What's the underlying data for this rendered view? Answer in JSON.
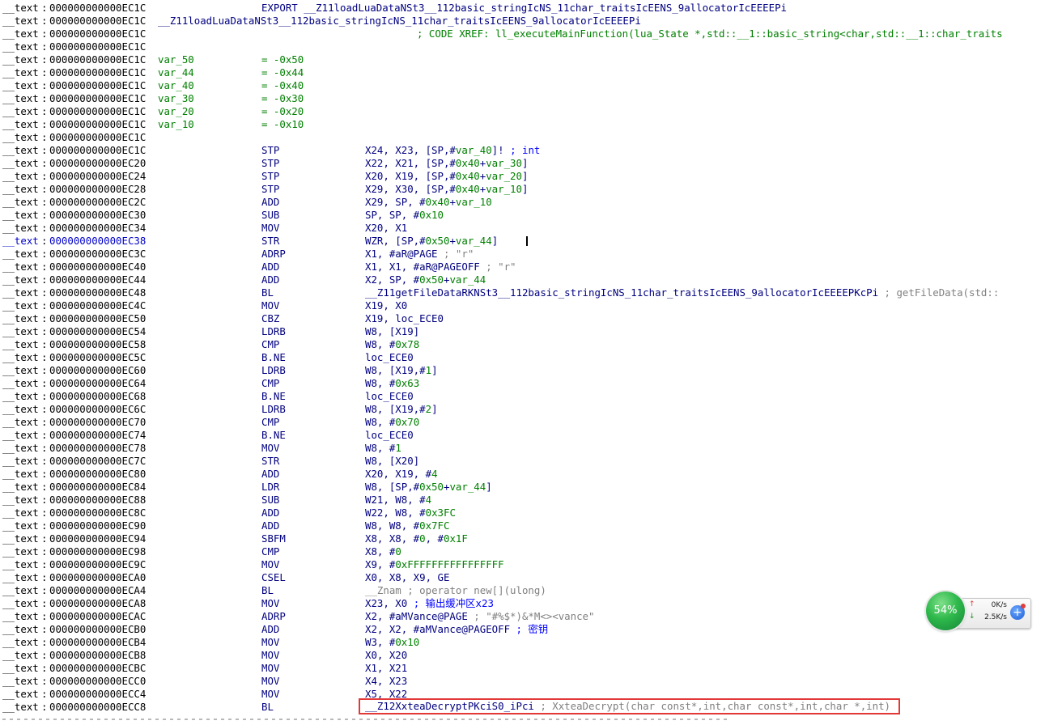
{
  "segment": "__text",
  "rows": [
    {
      "addr": "000000000000EC1C",
      "c323": [
        [
          "EXPORT",
          "navy"
        ],
        [
          " __Z11loadLuaDataNSt3__112basic_stringIcNS_11char_traitsIcEENS_9allocatorIcEEEEPi",
          "navy"
        ]
      ]
    },
    {
      "addr": "000000000000EC1C",
      "c195": [
        [
          "__Z11loadLuaDataNSt3__112basic_stringIcNS_11char_traitsIcEENS_9allocatorIcEEEEPi",
          "navy"
        ]
      ]
    },
    {
      "addr": "000000000000EC1C",
      "c515": [
        [
          "; CODE XREF: ll_executeMainFunction(lua_State *,std::__1::basic_string<char,std::__1::char_traits",
          "green"
        ]
      ]
    },
    {
      "addr": "000000000000EC1C"
    },
    {
      "addr": "000000000000EC1C",
      "c195": [
        [
          "var_50",
          "green"
        ]
      ],
      "c323": [
        [
          "= -0x50",
          "green"
        ]
      ]
    },
    {
      "addr": "000000000000EC1C",
      "c195": [
        [
          "var_44",
          "green"
        ]
      ],
      "c323": [
        [
          "= -0x44",
          "green"
        ]
      ]
    },
    {
      "addr": "000000000000EC1C",
      "c195": [
        [
          "var_40",
          "green"
        ]
      ],
      "c323": [
        [
          "= -0x40",
          "green"
        ]
      ]
    },
    {
      "addr": "000000000000EC1C",
      "c195": [
        [
          "var_30",
          "green"
        ]
      ],
      "c323": [
        [
          "= -0x30",
          "green"
        ]
      ]
    },
    {
      "addr": "000000000000EC1C",
      "c195": [
        [
          "var_20",
          "green"
        ]
      ],
      "c323": [
        [
          "= -0x20",
          "green"
        ]
      ]
    },
    {
      "addr": "000000000000EC1C",
      "c195": [
        [
          "var_10",
          "green"
        ]
      ],
      "c323": [
        [
          "= -0x10",
          "green"
        ]
      ]
    },
    {
      "addr": "000000000000EC1C"
    },
    {
      "addr": "000000000000EC1C",
      "op": "STP",
      "c451": [
        [
          "X24, X23, [SP,#",
          "navy"
        ],
        [
          "var_40",
          "green"
        ],
        [
          "]! ",
          "navy"
        ],
        [
          "; int",
          "blue"
        ]
      ]
    },
    {
      "addr": "000000000000EC20",
      "op": "STP",
      "c451": [
        [
          "X22, X21, [SP,#",
          "navy"
        ],
        [
          "0x40",
          "green"
        ],
        [
          "+",
          "navy"
        ],
        [
          "var_30",
          "green"
        ],
        [
          "]",
          "navy"
        ]
      ]
    },
    {
      "addr": "000000000000EC24",
      "op": "STP",
      "c451": [
        [
          "X20, X19, [SP,#",
          "navy"
        ],
        [
          "0x40",
          "green"
        ],
        [
          "+",
          "navy"
        ],
        [
          "var_20",
          "green"
        ],
        [
          "]",
          "navy"
        ]
      ]
    },
    {
      "addr": "000000000000EC28",
      "op": "STP",
      "c451": [
        [
          "X29, X30, [SP,#",
          "navy"
        ],
        [
          "0x40",
          "green"
        ],
        [
          "+",
          "navy"
        ],
        [
          "var_10",
          "green"
        ],
        [
          "]",
          "navy"
        ]
      ]
    },
    {
      "addr": "000000000000EC2C",
      "op": "ADD",
      "c451": [
        [
          "X29, SP, #",
          "navy"
        ],
        [
          "0x40",
          "green"
        ],
        [
          "+",
          "navy"
        ],
        [
          "var_10",
          "green"
        ]
      ]
    },
    {
      "addr": "000000000000EC30",
      "op": "SUB",
      "c451": [
        [
          "SP, SP, #",
          "navy"
        ],
        [
          "0x10",
          "green"
        ]
      ]
    },
    {
      "addr": "000000000000EC34",
      "op": "MOV",
      "c451": [
        [
          "X20, X1",
          "navy"
        ]
      ]
    },
    {
      "addr": "000000000000EC38",
      "op": "STR",
      "cur": true,
      "c451": [
        [
          "WZR, [SP,#",
          "navy"
        ],
        [
          "0x50",
          "green"
        ],
        [
          "+",
          "navy"
        ],
        [
          "var_44",
          "green"
        ],
        [
          "]",
          "navy"
        ]
      ]
    },
    {
      "addr": "000000000000EC3C",
      "op": "ADRP",
      "c451": [
        [
          "X1, #aR@PAGE ",
          "navy"
        ],
        [
          "; \"r\"",
          "grey"
        ]
      ]
    },
    {
      "addr": "000000000000EC40",
      "op": "ADD",
      "c451": [
        [
          "X1, X1, #aR@PAGEOFF ",
          "navy"
        ],
        [
          "; \"r\"",
          "grey"
        ]
      ]
    },
    {
      "addr": "000000000000EC44",
      "op": "ADD",
      "c451": [
        [
          "X2, SP, #",
          "navy"
        ],
        [
          "0x50",
          "green"
        ],
        [
          "+",
          "navy"
        ],
        [
          "var_44",
          "green"
        ]
      ]
    },
    {
      "addr": "000000000000EC48",
      "op": "BL",
      "c451": [
        [
          "__Z11getFileDataRKNSt3__112basic_stringIcNS_11char_traitsIcEENS_9allocatorIcEEEEPKcPi",
          "navy"
        ],
        [
          " ; getFileData(std::",
          "grey"
        ]
      ]
    },
    {
      "addr": "000000000000EC4C",
      "op": "MOV",
      "c451": [
        [
          "X19, X0",
          "navy"
        ]
      ]
    },
    {
      "addr": "000000000000EC50",
      "op": "CBZ",
      "c451": [
        [
          "X19, loc_ECE0",
          "navy"
        ]
      ]
    },
    {
      "addr": "000000000000EC54",
      "op": "LDRB",
      "c451": [
        [
          "W8, [X19]",
          "navy"
        ]
      ]
    },
    {
      "addr": "000000000000EC58",
      "op": "CMP",
      "c451": [
        [
          "W8, #",
          "navy"
        ],
        [
          "0x78",
          "green"
        ]
      ]
    },
    {
      "addr": "000000000000EC5C",
      "op": "B.NE",
      "c451": [
        [
          "loc_ECE0",
          "navy"
        ]
      ]
    },
    {
      "addr": "000000000000EC60",
      "op": "LDRB",
      "c451": [
        [
          "W8, [X19,#",
          "navy"
        ],
        [
          "1",
          "green"
        ],
        [
          "]",
          "navy"
        ]
      ]
    },
    {
      "addr": "000000000000EC64",
      "op": "CMP",
      "c451": [
        [
          "W8, #",
          "navy"
        ],
        [
          "0x63",
          "green"
        ]
      ]
    },
    {
      "addr": "000000000000EC68",
      "op": "B.NE",
      "c451": [
        [
          "loc_ECE0",
          "navy"
        ]
      ]
    },
    {
      "addr": "000000000000EC6C",
      "op": "LDRB",
      "c451": [
        [
          "W8, [X19,#",
          "navy"
        ],
        [
          "2",
          "green"
        ],
        [
          "]",
          "navy"
        ]
      ]
    },
    {
      "addr": "000000000000EC70",
      "op": "CMP",
      "c451": [
        [
          "W8, #",
          "navy"
        ],
        [
          "0x70",
          "green"
        ]
      ]
    },
    {
      "addr": "000000000000EC74",
      "op": "B.NE",
      "c451": [
        [
          "loc_ECE0",
          "navy"
        ]
      ]
    },
    {
      "addr": "000000000000EC78",
      "op": "MOV",
      "c451": [
        [
          "W8, #",
          "navy"
        ],
        [
          "1",
          "green"
        ]
      ]
    },
    {
      "addr": "000000000000EC7C",
      "op": "STR",
      "c451": [
        [
          "W8, [X20]",
          "navy"
        ]
      ]
    },
    {
      "addr": "000000000000EC80",
      "op": "ADD",
      "c451": [
        [
          "X20, X19, #",
          "navy"
        ],
        [
          "4",
          "green"
        ]
      ]
    },
    {
      "addr": "000000000000EC84",
      "op": "LDR",
      "c451": [
        [
          "W8, [SP,#",
          "navy"
        ],
        [
          "0x50",
          "green"
        ],
        [
          "+",
          "navy"
        ],
        [
          "var_44",
          "green"
        ],
        [
          "]",
          "navy"
        ]
      ]
    },
    {
      "addr": "000000000000EC88",
      "op": "SUB",
      "c451": [
        [
          "W21, W8, #",
          "navy"
        ],
        [
          "4",
          "green"
        ]
      ]
    },
    {
      "addr": "000000000000EC8C",
      "op": "ADD",
      "c451": [
        [
          "W22, W8, #",
          "navy"
        ],
        [
          "0x3FC",
          "green"
        ]
      ]
    },
    {
      "addr": "000000000000EC90",
      "op": "ADD",
      "c451": [
        [
          "W8, W8, #",
          "navy"
        ],
        [
          "0x7FC",
          "green"
        ]
      ]
    },
    {
      "addr": "000000000000EC94",
      "op": "SBFM",
      "c451": [
        [
          "X8, X8, #",
          "navy"
        ],
        [
          "0",
          "green"
        ],
        [
          ", #",
          "navy"
        ],
        [
          "0x1F",
          "green"
        ]
      ]
    },
    {
      "addr": "000000000000EC98",
      "op": "CMP",
      "c451": [
        [
          "X8, #",
          "navy"
        ],
        [
          "0",
          "green"
        ]
      ]
    },
    {
      "addr": "000000000000EC9C",
      "op": "MOV",
      "c451": [
        [
          "X9, #",
          "navy"
        ],
        [
          "0xFFFFFFFFFFFFFFFF",
          "green"
        ]
      ]
    },
    {
      "addr": "000000000000ECA0",
      "op": "CSEL",
      "c451": [
        [
          "X0, X8, X9, GE",
          "navy"
        ]
      ]
    },
    {
      "addr": "000000000000ECA4",
      "op": "BL",
      "c451": [
        [
          "__Znam",
          "grey"
        ],
        [
          "  ; operator new[](ulong)",
          "grey"
        ]
      ]
    },
    {
      "addr": "000000000000ECA8",
      "op": "MOV",
      "c451": [
        [
          "X23, X0 ",
          "navy"
        ],
        [
          "; 输出缓冲区x23",
          "blue"
        ]
      ]
    },
    {
      "addr": "000000000000ECAC",
      "op": "ADRP",
      "c451": [
        [
          "X2, #aMVance@PAGE ",
          "navy"
        ],
        [
          "; \"#%$*)&*M<><vance\"",
          "grey"
        ]
      ]
    },
    {
      "addr": "000000000000ECB0",
      "op": "ADD",
      "c451": [
        [
          "X2, X2, #aMVance@PAGEOFF ",
          "navy"
        ],
        [
          "; 密钥",
          "blue"
        ]
      ]
    },
    {
      "addr": "000000000000ECB4",
      "op": "MOV",
      "c451": [
        [
          "W3, #",
          "navy"
        ],
        [
          "0x10",
          "green"
        ]
      ]
    },
    {
      "addr": "000000000000ECB8",
      "op": "MOV",
      "c451": [
        [
          "X0, X20",
          "navy"
        ]
      ]
    },
    {
      "addr": "000000000000ECBC",
      "op": "MOV",
      "c451": [
        [
          "X1, X21",
          "navy"
        ]
      ]
    },
    {
      "addr": "000000000000ECC0",
      "op": "MOV",
      "c451": [
        [
          "X4, X23",
          "navy"
        ]
      ]
    },
    {
      "addr": "000000000000ECC4",
      "op": "MOV",
      "c451": [
        [
          "X5, X22",
          "navy"
        ]
      ]
    },
    {
      "addr": "000000000000ECC8",
      "op": "BL",
      "hl": true,
      "c451": [
        [
          "__Z12XxteaDecryptPKciS0_iPci",
          "navy"
        ],
        [
          " ; XxteaDecrypt(char const*,int,char const*,int,char *,int)",
          "grey"
        ]
      ]
    }
  ],
  "widget": {
    "percent": "54%",
    "up_speed": "0K/s",
    "down_speed": "2.5K/s",
    "up_arrow": "↑",
    "down_arrow": "↓",
    "plus": "+",
    "colors": {
      "ball": "#2eb84b",
      "plus": "#1f5fd6",
      "alert": "#e23b3b"
    }
  },
  "colors": {
    "text_navy": "#000080",
    "constant_green": "#008000",
    "comment_grey": "#808080",
    "comment_blue": "#0000ff",
    "current_line": "#0000c8",
    "highlight_box": "#e23838"
  }
}
